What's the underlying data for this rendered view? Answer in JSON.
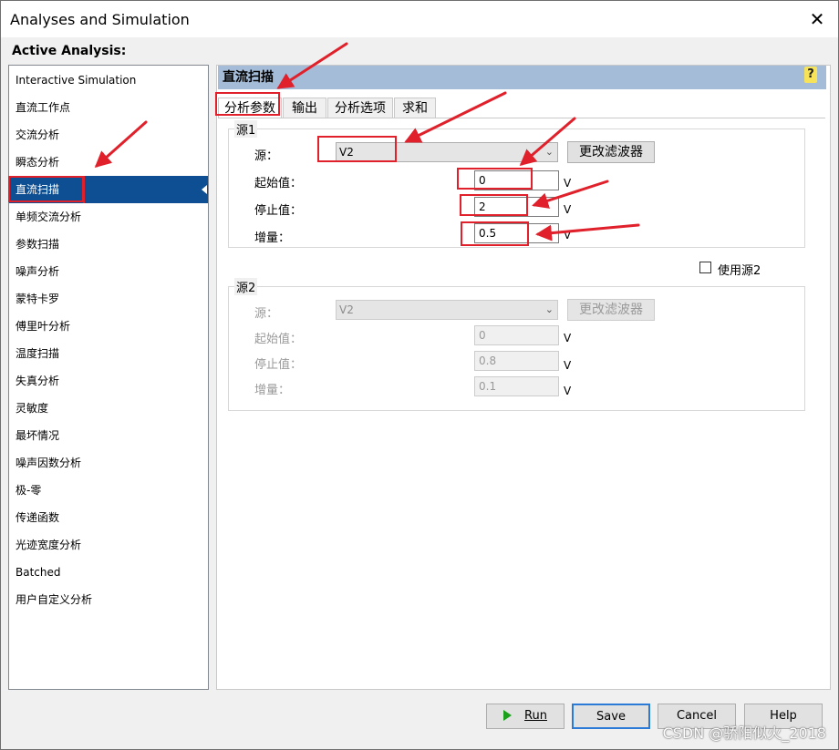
{
  "window": {
    "title": "Analyses and Simulation",
    "close": "✕"
  },
  "active_label": "Active Analysis:",
  "analyses": [
    "Interactive Simulation",
    "直流工作点",
    "交流分析",
    "瞬态分析",
    "直流扫描",
    "单频交流分析",
    "参数扫描",
    "噪声分析",
    "蒙特卡罗",
    "傅里叶分析",
    "温度扫描",
    "失真分析",
    "灵敏度",
    "最坏情况",
    "噪声因数分析",
    "极-零",
    "传递函数",
    "光迹宽度分析",
    "Batched",
    "用户自定义分析"
  ],
  "selected_index": 4,
  "panel": {
    "title": "直流扫描",
    "help": "?"
  },
  "tabs": [
    "分析参数",
    "输出",
    "分析选项",
    "求和"
  ],
  "source1": {
    "group": "源1",
    "source_label": "源：",
    "source_value": "V2",
    "filter_button": "更改滤波器",
    "start_label": "起始值：",
    "start_value": "0",
    "stop_label": "停止值：",
    "stop_value": "2",
    "step_label": "增量：",
    "step_value": "0.5",
    "unit": "V"
  },
  "use_source2": "使用源2",
  "source2": {
    "group": "源2",
    "source_label": "源：",
    "source_value": "V2",
    "filter_button": "更改滤波器",
    "start_label": "起始值：",
    "start_value": "0",
    "stop_label": "停止值：",
    "stop_value": "0.8",
    "step_label": "增量：",
    "step_value": "0.1",
    "unit": "V"
  },
  "buttons": {
    "run": "Run",
    "save": "Save",
    "cancel": "Cancel",
    "help": "Help"
  },
  "watermark": "CSDN @骄阳似火_2018",
  "colors": {
    "selection": "#0d4f92",
    "header": "#a4bcd8",
    "annotation": "#e0202a"
  }
}
